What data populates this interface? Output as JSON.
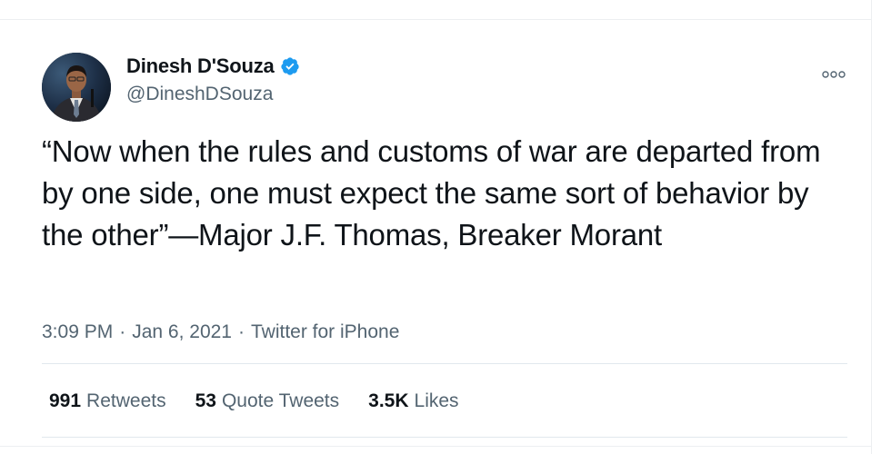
{
  "author": {
    "name": "Dinesh D'Souza",
    "handle": "@DineshDSouza",
    "verified": true,
    "avatar_icon": "profile-photo-man-in-suit"
  },
  "tweet": {
    "text": "“Now when the rules and customs of war are departed from by one side, one must expect the same sort of behavior by the other”—Major J.F. Thomas, Breaker Morant"
  },
  "meta": {
    "time": "3:09 PM",
    "date": "Jan 6, 2021",
    "source": "Twitter for iPhone",
    "separator": "·"
  },
  "stats": {
    "retweets_count": "991",
    "retweets_label": "Retweets",
    "quote_count": "53",
    "quote_label": "Quote Tweets",
    "likes_count": "3.5K",
    "likes_label": "Likes"
  },
  "colors": {
    "text_primary": "#0f1419",
    "text_secondary": "#536471",
    "verified_blue": "#1d9bf0",
    "divider": "#e1e8ed"
  },
  "icons": {
    "verified": "verified-badge-icon",
    "more": "more-options-icon"
  }
}
